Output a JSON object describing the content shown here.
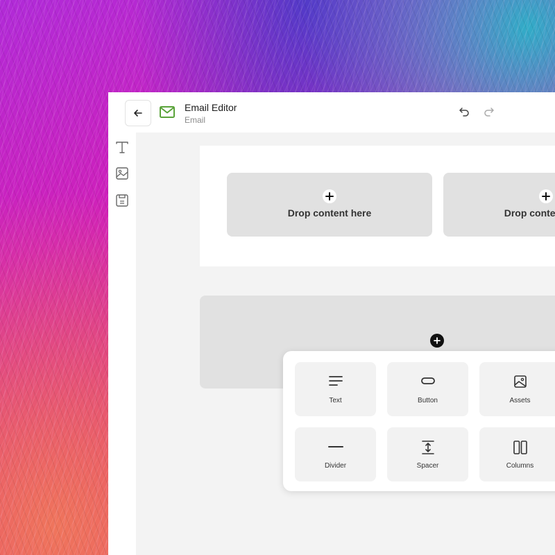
{
  "app": {
    "title": "Email Editor",
    "subtitle": "Email",
    "accent_color": "#5aa33a"
  },
  "toolbar": {
    "back_icon": "arrow-left-icon",
    "undo_icon": "undo-icon",
    "redo_icon": "redo-icon"
  },
  "sidebar": {
    "items": [
      {
        "icon": "text-icon"
      },
      {
        "icon": "image-icon"
      },
      {
        "icon": "template-icon"
      }
    ]
  },
  "canvas": {
    "drop_zones": [
      {
        "label": "Drop content here"
      },
      {
        "label": "Drop content here"
      }
    ]
  },
  "block_picker": {
    "items": [
      {
        "label": "Text",
        "icon": "text-align-icon"
      },
      {
        "label": "Button",
        "icon": "button-icon"
      },
      {
        "label": "Assets",
        "icon": "image-icon"
      },
      {
        "label": "Divider",
        "icon": "divider-icon"
      },
      {
        "label": "Spacer",
        "icon": "spacer-icon"
      },
      {
        "label": "Columns",
        "icon": "columns-icon"
      }
    ]
  }
}
